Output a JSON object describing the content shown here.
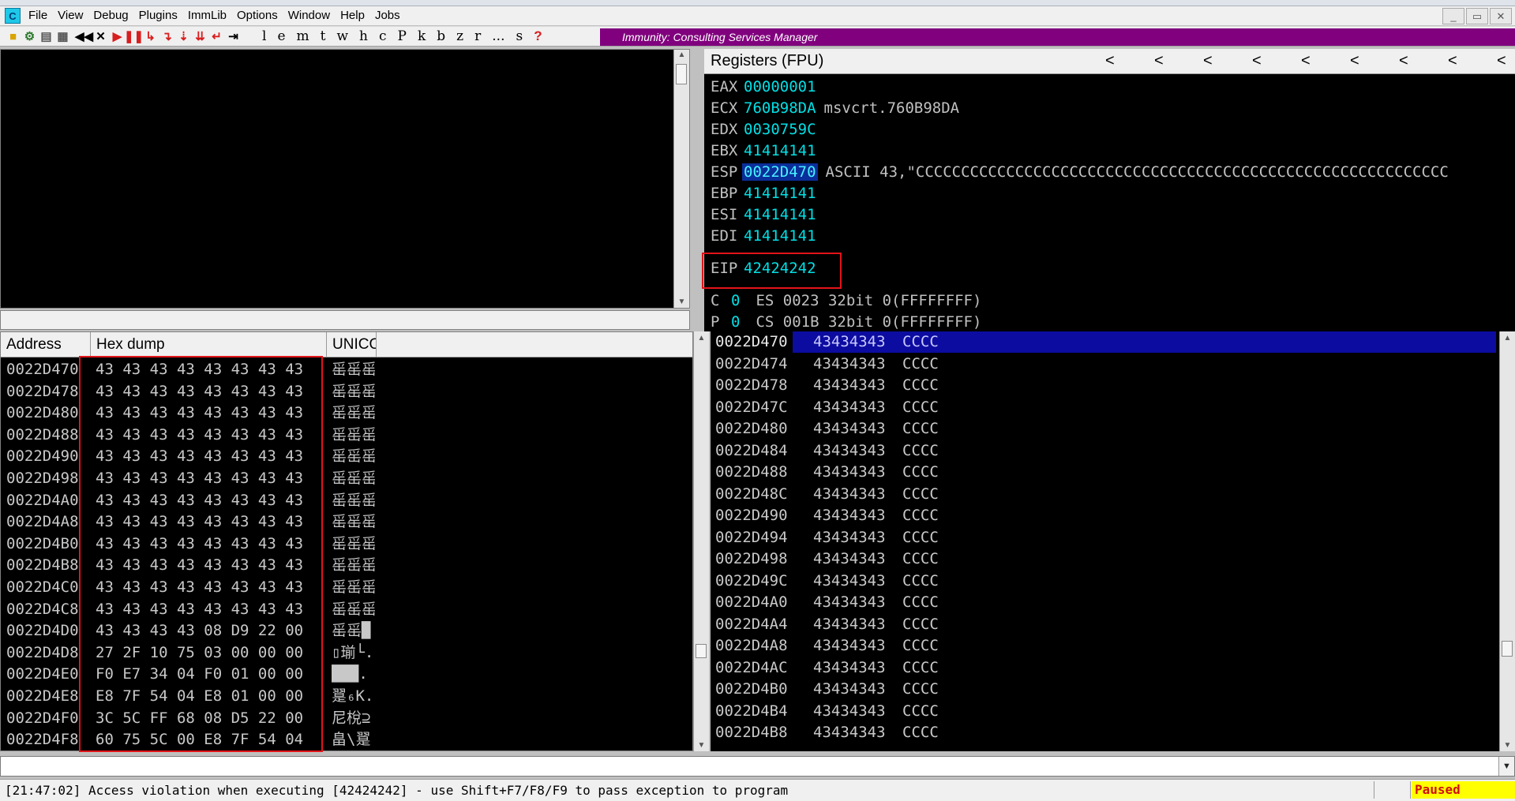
{
  "menu": [
    "File",
    "View",
    "Debug",
    "Plugins",
    "ImmLib",
    "Options",
    "Window",
    "Help",
    "Jobs"
  ],
  "app_icon_letter": "C",
  "toolbar_letters": [
    "l",
    "e",
    "m",
    "t",
    "w",
    "h",
    "c",
    "P",
    "k",
    "b",
    "z",
    "r",
    "...",
    "s",
    "?"
  ],
  "banner_text": "Immunity: Consulting Services Manager",
  "registers": {
    "title": "Registers (FPU)",
    "rows": [
      {
        "name": "EAX",
        "value": "00000001",
        "comment": ""
      },
      {
        "name": "ECX",
        "value": "760B98DA",
        "comment": "msvcrt.760B98DA"
      },
      {
        "name": "EDX",
        "value": "0030759C",
        "comment": ""
      },
      {
        "name": "EBX",
        "value": "41414141",
        "comment": ""
      },
      {
        "name": "ESP",
        "value": "0022D470",
        "comment": "ASCII 43,\"CCCCCCCCCCCCCCCCCCCCCCCCCCCCCCCCCCCCCCCCCCCCCCCCCCCCCCCCCCC"
      },
      {
        "name": "EBP",
        "value": "41414141",
        "comment": ""
      },
      {
        "name": "ESI",
        "value": "41414141",
        "comment": ""
      },
      {
        "name": "EDI",
        "value": "41414141",
        "comment": ""
      }
    ],
    "eip": {
      "name": "EIP",
      "value": "42424242"
    },
    "flags": [
      {
        "name": "C",
        "value": "0",
        "seg": "ES 0023 32bit 0(FFFFFFFF)"
      },
      {
        "name": "P",
        "value": "0",
        "seg": "CS 001B 32bit 0(FFFFFFFF)"
      }
    ]
  },
  "hex": {
    "headers": {
      "address": "Address",
      "hex": "Hex dump",
      "unicode": "UNICO"
    },
    "rows": [
      {
        "addr": "0022D470",
        "bytes": "43 43 43 43 43 43 43 43",
        "uni": "䍃䍃䍃"
      },
      {
        "addr": "0022D478",
        "bytes": "43 43 43 43 43 43 43 43",
        "uni": "䍃䍃䍃"
      },
      {
        "addr": "0022D480",
        "bytes": "43 43 43 43 43 43 43 43",
        "uni": "䍃䍃䍃"
      },
      {
        "addr": "0022D488",
        "bytes": "43 43 43 43 43 43 43 43",
        "uni": "䍃䍃䍃"
      },
      {
        "addr": "0022D490",
        "bytes": "43 43 43 43 43 43 43 43",
        "uni": "䍃䍃䍃"
      },
      {
        "addr": "0022D498",
        "bytes": "43 43 43 43 43 43 43 43",
        "uni": "䍃䍃䍃"
      },
      {
        "addr": "0022D4A0",
        "bytes": "43 43 43 43 43 43 43 43",
        "uni": "䍃䍃䍃"
      },
      {
        "addr": "0022D4A8",
        "bytes": "43 43 43 43 43 43 43 43",
        "uni": "䍃䍃䍃"
      },
      {
        "addr": "0022D4B0",
        "bytes": "43 43 43 43 43 43 43 43",
        "uni": "䍃䍃䍃"
      },
      {
        "addr": "0022D4B8",
        "bytes": "43 43 43 43 43 43 43 43",
        "uni": "䍃䍃䍃"
      },
      {
        "addr": "0022D4C0",
        "bytes": "43 43 43 43 43 43 43 43",
        "uni": "䍃䍃䍃"
      },
      {
        "addr": "0022D4C8",
        "bytes": "43 43 43 43 43 43 43 43",
        "uni": "䍃䍃䍃"
      },
      {
        "addr": "0022D4D0",
        "bytes": "43 43 43 43 08 D9 22 00",
        "uni": "䍃䍃█"
      },
      {
        "addr": "0022D4D8",
        "bytes": "27 2F 10 75 03 00 00 00",
        "uni": "▯瑐└."
      },
      {
        "addr": "0022D4E0",
        "bytes": "F0 E7 34 04 F0 01 00 00",
        "uni": "███."
      },
      {
        "addr": "0022D4E8",
        "bytes": "E8 7F 54 04 E8 01 00 00",
        "uni": "翨₆K."
      },
      {
        "addr": "0022D4F0",
        "bytes": "3C 5C FF 68 08 D5 22 00",
        "uni": "尼梲⊇"
      },
      {
        "addr": "0022D4F8",
        "bytes": "60 75 5C 00 E8 7F 54 04",
        "uni": "畠\\翨"
      }
    ]
  },
  "stack": {
    "rows": [
      {
        "addr": "0022D470",
        "val": "43434343",
        "asc": "CCCC"
      },
      {
        "addr": "0022D474",
        "val": "43434343",
        "asc": "CCCC"
      },
      {
        "addr": "0022D478",
        "val": "43434343",
        "asc": "CCCC"
      },
      {
        "addr": "0022D47C",
        "val": "43434343",
        "asc": "CCCC"
      },
      {
        "addr": "0022D480",
        "val": "43434343",
        "asc": "CCCC"
      },
      {
        "addr": "0022D484",
        "val": "43434343",
        "asc": "CCCC"
      },
      {
        "addr": "0022D488",
        "val": "43434343",
        "asc": "CCCC"
      },
      {
        "addr": "0022D48C",
        "val": "43434343",
        "asc": "CCCC"
      },
      {
        "addr": "0022D490",
        "val": "43434343",
        "asc": "CCCC"
      },
      {
        "addr": "0022D494",
        "val": "43434343",
        "asc": "CCCC"
      },
      {
        "addr": "0022D498",
        "val": "43434343",
        "asc": "CCCC"
      },
      {
        "addr": "0022D49C",
        "val": "43434343",
        "asc": "CCCC"
      },
      {
        "addr": "0022D4A0",
        "val": "43434343",
        "asc": "CCCC"
      },
      {
        "addr": "0022D4A4",
        "val": "43434343",
        "asc": "CCCC"
      },
      {
        "addr": "0022D4A8",
        "val": "43434343",
        "asc": "CCCC"
      },
      {
        "addr": "0022D4AC",
        "val": "43434343",
        "asc": "CCCC"
      },
      {
        "addr": "0022D4B0",
        "val": "43434343",
        "asc": "CCCC"
      },
      {
        "addr": "0022D4B4",
        "val": "43434343",
        "asc": "CCCC"
      },
      {
        "addr": "0022D4B8",
        "val": "43434343",
        "asc": "CCCC"
      }
    ]
  },
  "status": {
    "message": "[21:47:02] Access violation when executing [42424242] - use Shift+F7/F8/F9 to pass exception to program",
    "state": "Paused"
  },
  "colors": {
    "banner": "#80007d",
    "register_value": "#00e0e6",
    "highlight_box": "#e2141a",
    "paused_bg": "#ffff00"
  }
}
